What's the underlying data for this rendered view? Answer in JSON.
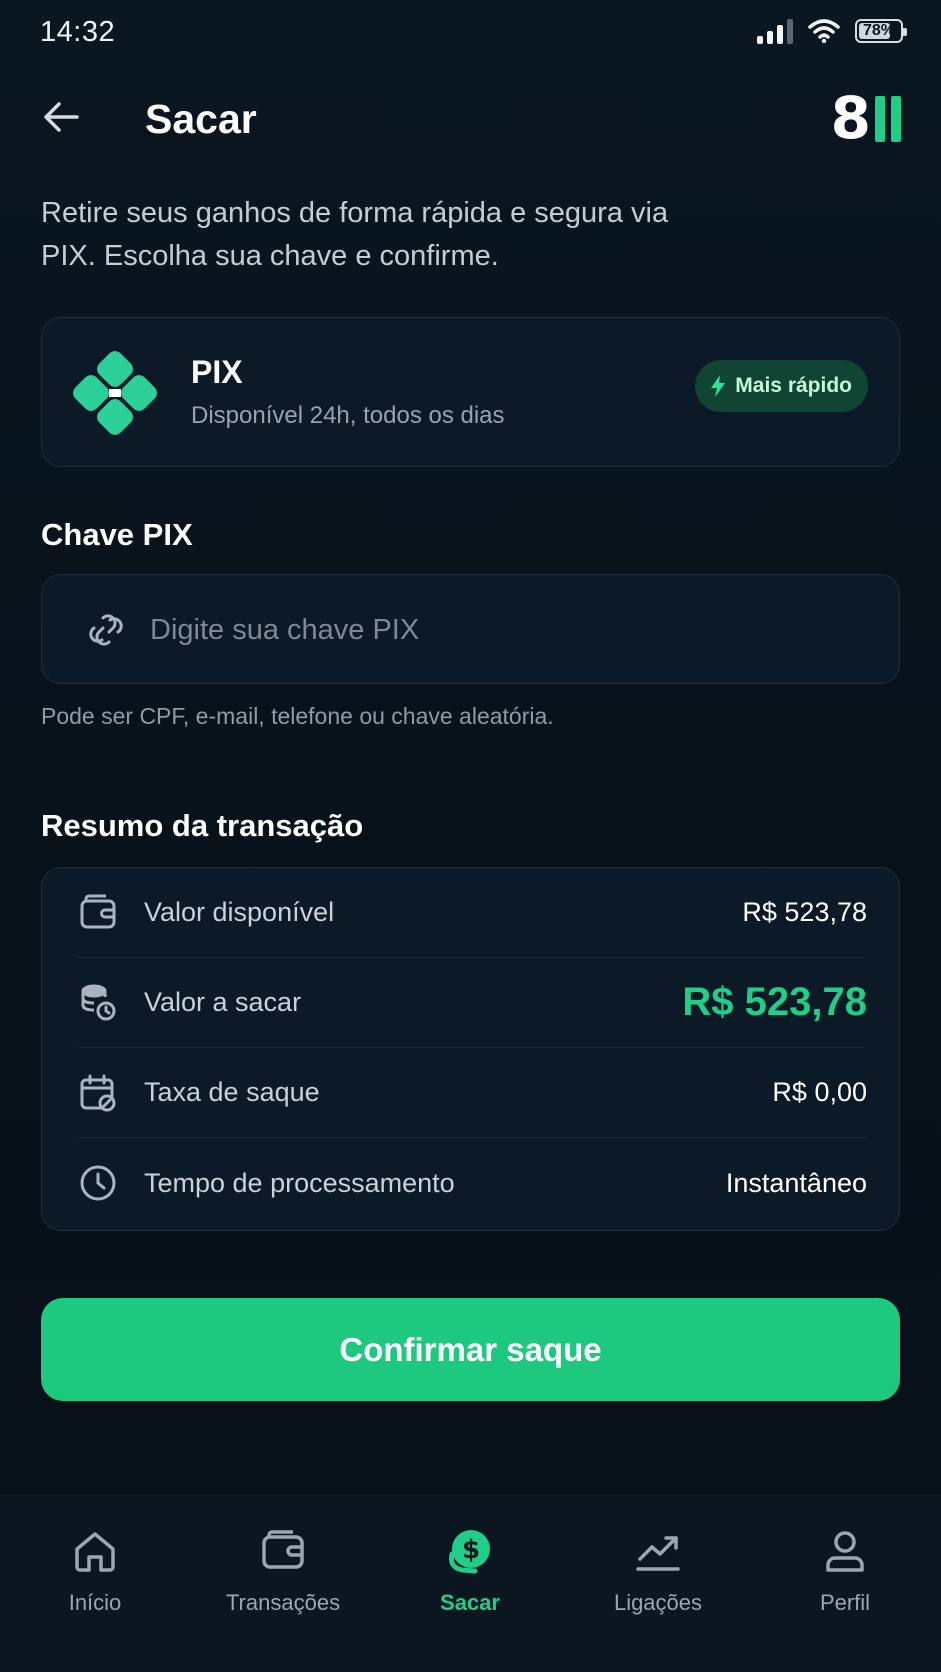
{
  "status_bar": {
    "time": "14:32",
    "battery": "78%",
    "battery_level": 0.78
  },
  "header": {
    "title": "Sacar",
    "logo_text": "8"
  },
  "intro": "Retire seus ganhos de forma rápida e segura via PIX. Escolha sua chave e confirme.",
  "pix_card": {
    "name": "PIX",
    "subtitle": "Disponível 24h, todos os dias",
    "badge": "Mais rápido"
  },
  "pix_key": {
    "label": "Chave PIX",
    "placeholder": "Digite sua chave PIX",
    "value": "",
    "hint": "Pode ser CPF, e-mail, telefone ou chave aleatória."
  },
  "summary": {
    "title": "Resumo da transação",
    "rows": [
      {
        "label": "Valor disponível",
        "value": "R$ 523,78",
        "icon": "wallet-icon"
      },
      {
        "label": "Valor a sacar",
        "value": "R$ 523,78",
        "icon": "coins-icon"
      },
      {
        "label": "Taxa de saque",
        "value": "R$ 0,00",
        "icon": "calendar-icon"
      },
      {
        "label": "Tempo de processamento",
        "value": "Instantâneo",
        "icon": "clock-icon"
      }
    ]
  },
  "confirm_button": "Confirmar saque",
  "nav": {
    "items": [
      {
        "label": "Início",
        "icon": "home-icon"
      },
      {
        "label": "Transações",
        "icon": "wallet-icon"
      },
      {
        "label": "Sacar",
        "icon": "dollar-icon",
        "active": true
      },
      {
        "label": "Ligações",
        "icon": "trend-icon"
      },
      {
        "label": "Perfil",
        "icon": "user-icon"
      }
    ]
  },
  "colors": {
    "accent": "#1fce87",
    "background": "#08121c",
    "card": "#0c1a27"
  }
}
